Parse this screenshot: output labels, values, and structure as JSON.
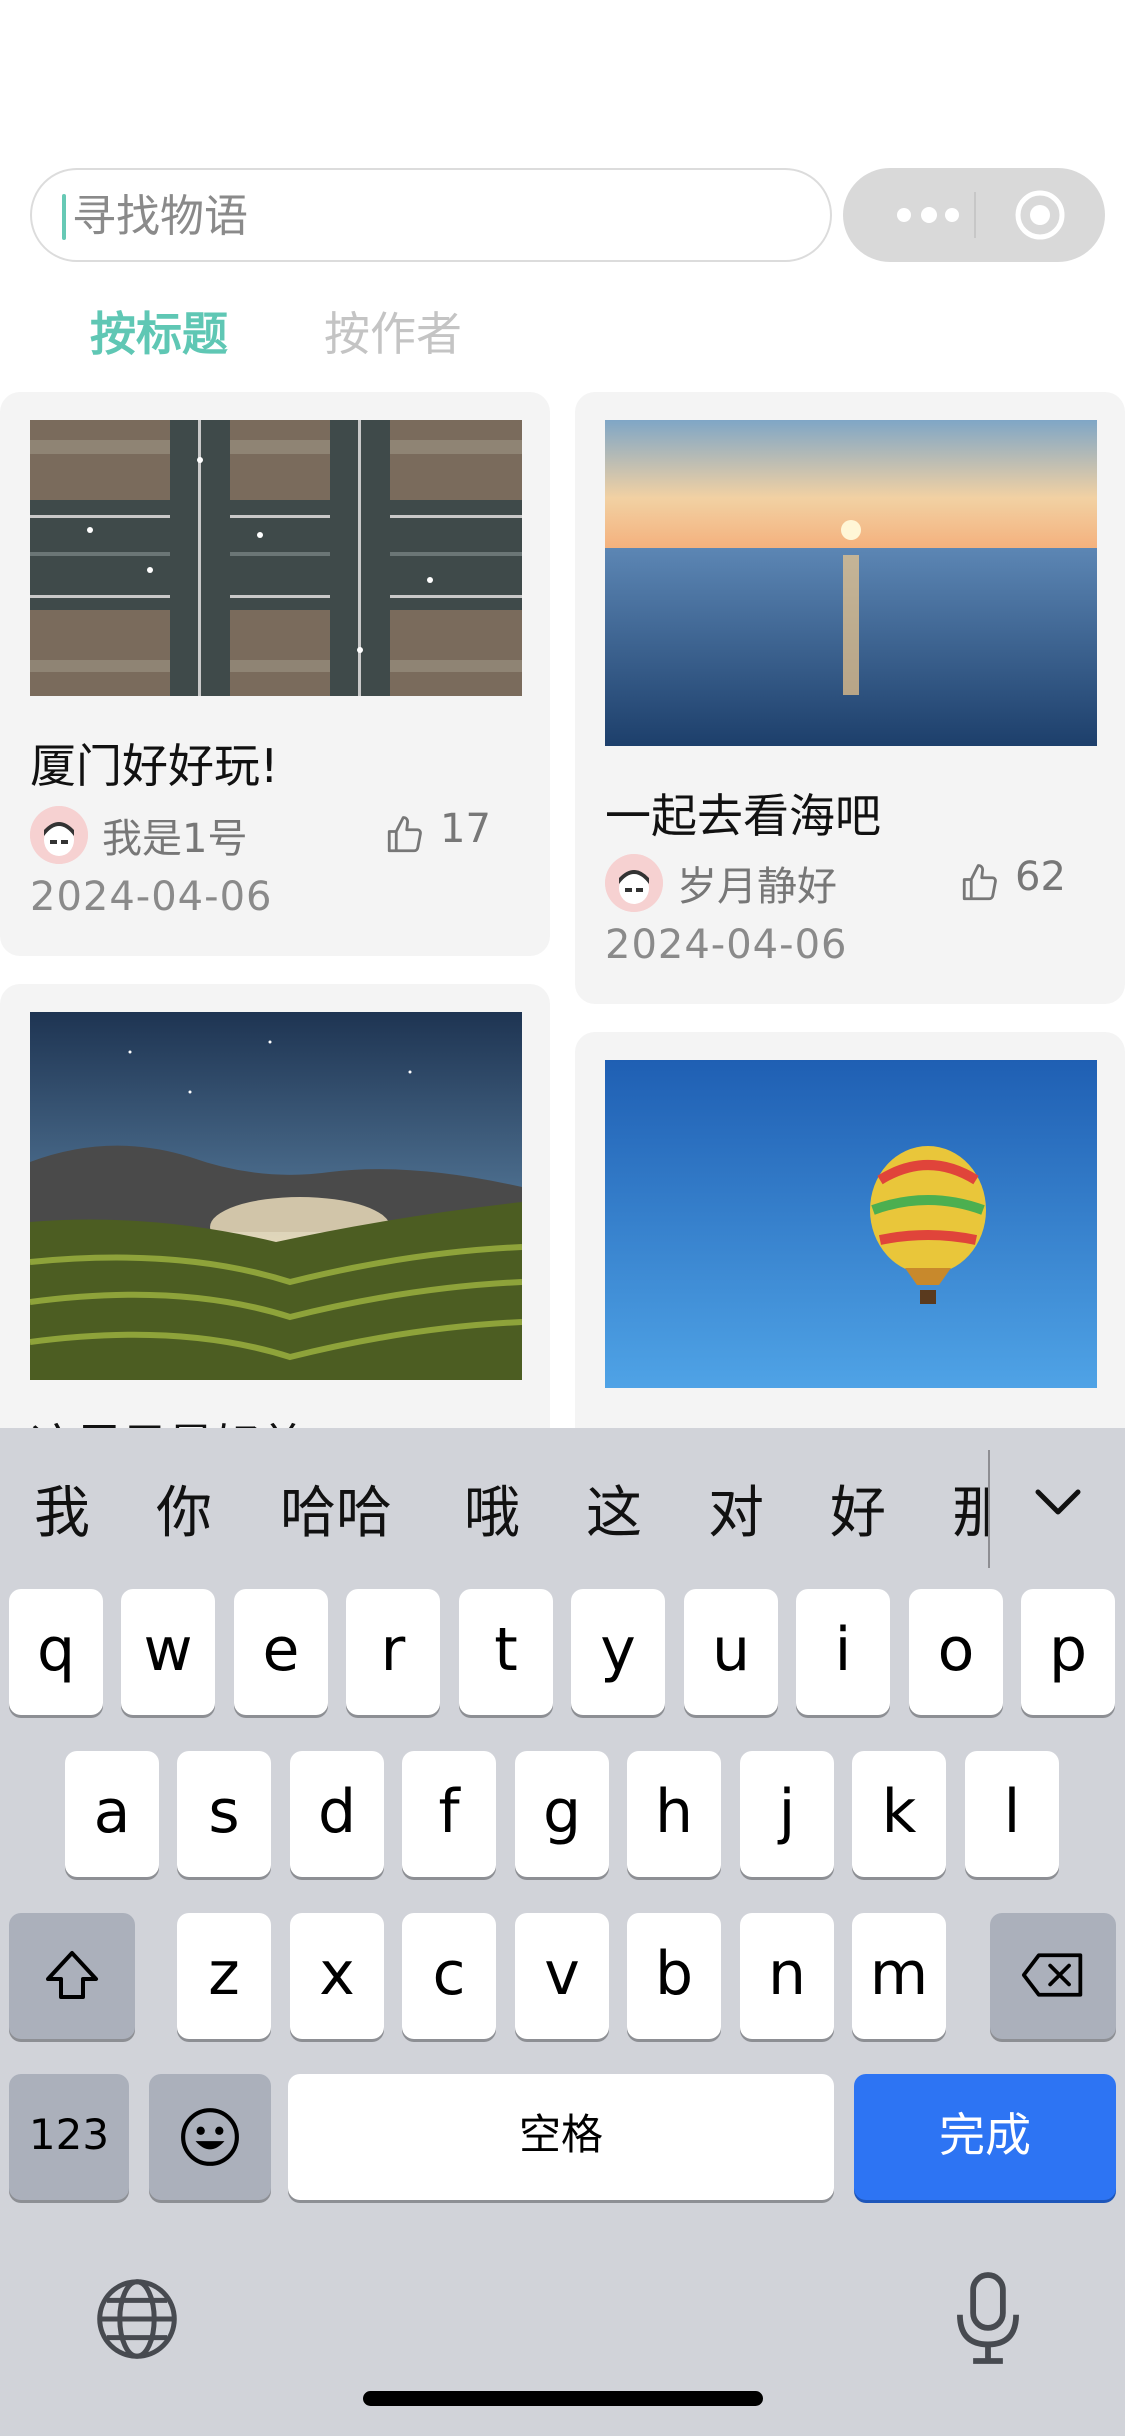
{
  "search": {
    "placeholder": "寻找物语"
  },
  "tabs": [
    {
      "label": "按标题",
      "active": true
    },
    {
      "label": "按作者",
      "active": false
    }
  ],
  "accent_color": "#5fc7b4",
  "posts": [
    {
      "title": "厦门好好玩!",
      "author": "我是1号",
      "likes": "17",
      "date": "2024-04-06",
      "image": "aerial-highway-interchange"
    },
    {
      "title": "一起去看海吧",
      "author": "岁月静好",
      "likes": "62",
      "date": "2024-04-06",
      "image": "sunset-over-sea"
    },
    {
      "title": "这里风景好美!",
      "image": "rice-terraces-night-sky"
    },
    {
      "image": "hot-air-balloon-blue-sky"
    }
  ],
  "keyboard": {
    "candidates": [
      "我",
      "你",
      "哈哈",
      "哦",
      "这",
      "对",
      "好",
      "那"
    ],
    "row1": [
      "q",
      "w",
      "e",
      "r",
      "t",
      "y",
      "u",
      "i",
      "o",
      "p"
    ],
    "row2": [
      "a",
      "s",
      "d",
      "f",
      "g",
      "h",
      "j",
      "k",
      "l"
    ],
    "row3": [
      "z",
      "x",
      "c",
      "v",
      "b",
      "n",
      "m"
    ],
    "numbers_label": "123",
    "space_label": "空格",
    "done_label": "完成",
    "done_color": "#2d74f3"
  }
}
